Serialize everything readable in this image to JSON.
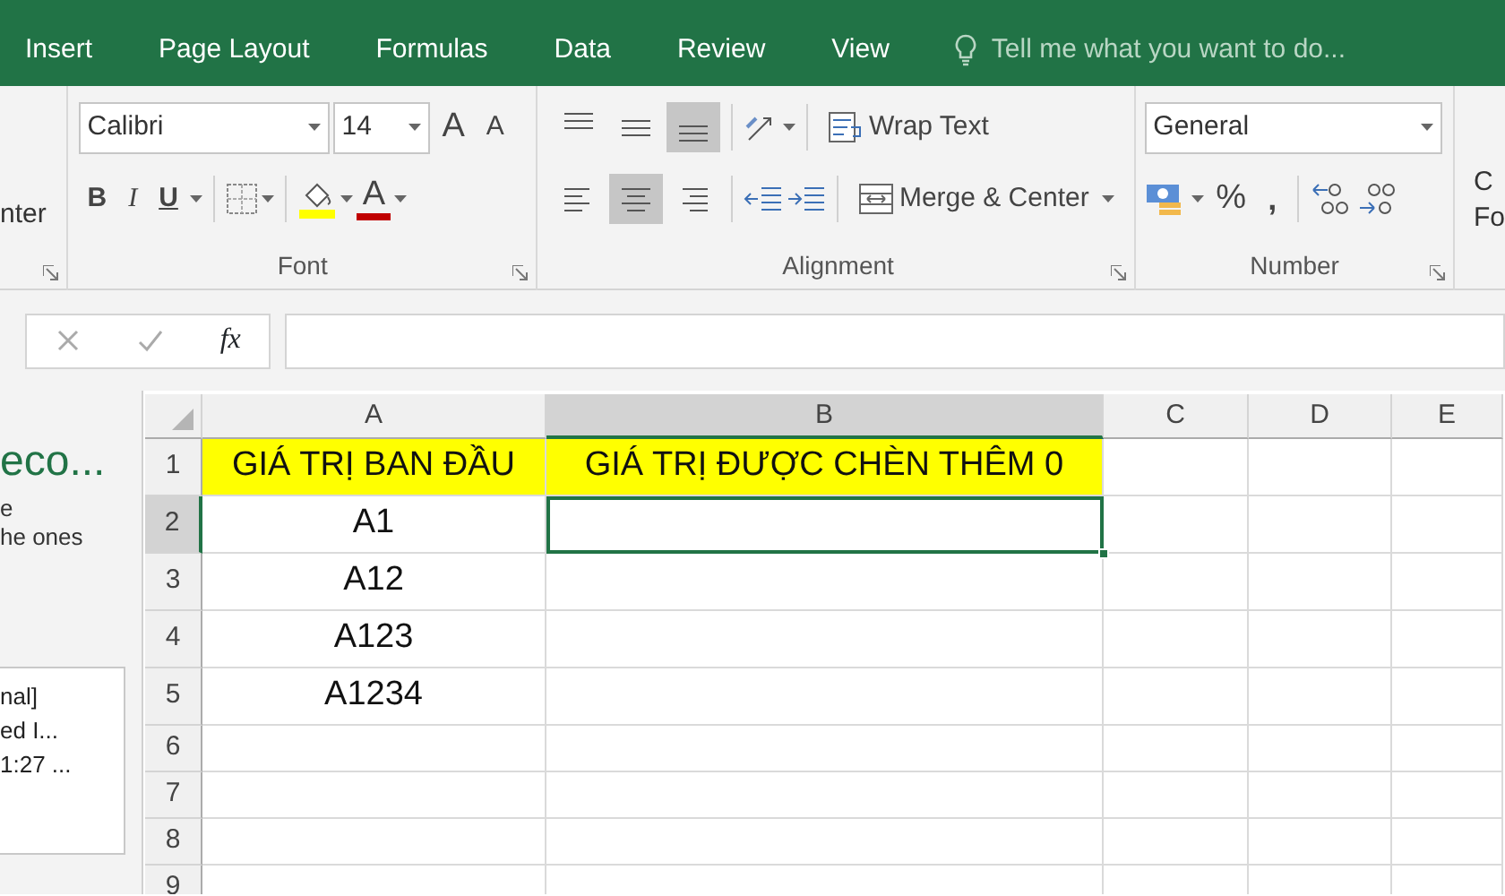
{
  "tabs": [
    {
      "label": "Insert",
      "selected": false
    },
    {
      "label": "Page Layout",
      "selected": false
    },
    {
      "label": "Formulas",
      "selected": false
    },
    {
      "label": "Data",
      "selected": false
    },
    {
      "label": "Review",
      "selected": false
    },
    {
      "label": "View",
      "selected": false
    }
  ],
  "tell_me": "Tell me what you want to do...",
  "ribbon": {
    "clipped_label": "nter",
    "font": {
      "name": "Calibri",
      "size": "14",
      "grow": "A",
      "shrink": "A",
      "bold": "B",
      "italic": "I",
      "underline": "U",
      "font_color": "A",
      "label": "Font"
    },
    "alignment": {
      "vertical": [
        {
          "kind": "top",
          "pressed": false
        },
        {
          "kind": "middle",
          "pressed": false
        },
        {
          "kind": "bottom",
          "pressed": true
        }
      ],
      "horizontal": [
        {
          "kind": "left",
          "pressed": false
        },
        {
          "kind": "center",
          "pressed": true
        },
        {
          "kind": "right",
          "pressed": false
        }
      ],
      "wrap": "Wrap Text",
      "merge": "Merge & Center",
      "label": "Alignment"
    },
    "number": {
      "format": "General",
      "percent": "%",
      "comma": ",",
      "label": "Number"
    },
    "clipped_group": [
      "C",
      "Fo"
    ]
  },
  "formula_bar": {
    "fx": "fx"
  },
  "side_panel": {
    "title": "eco...",
    "lines": [
      "e",
      "he ones"
    ],
    "file_lines": [
      "nal]",
      "ed I...",
      "1:27 ..."
    ]
  },
  "sheet": {
    "columns": [
      {
        "label": "A",
        "selected": false
      },
      {
        "label": "B",
        "selected": true
      },
      {
        "label": "C",
        "selected": false
      },
      {
        "label": "D",
        "selected": false
      },
      {
        "label": "E",
        "selected": false
      }
    ],
    "rows": [
      {
        "label": "1",
        "selected": false,
        "highlight": true,
        "cells": [
          "GIÁ TRỊ BAN ĐẦU",
          "GIÁ TRỊ ĐƯỢC CHÈN THÊM 0"
        ]
      },
      {
        "label": "2",
        "selected": true,
        "highlight": false,
        "cells": [
          "A1"
        ]
      },
      {
        "label": "3",
        "selected": false,
        "highlight": false,
        "cells": [
          "A12"
        ]
      },
      {
        "label": "4",
        "selected": false,
        "highlight": false,
        "cells": [
          "A123"
        ]
      },
      {
        "label": "5",
        "selected": false,
        "highlight": false,
        "cells": [
          "A1234"
        ]
      },
      {
        "label": "6",
        "selected": false,
        "highlight": false,
        "cells": []
      },
      {
        "label": "7",
        "selected": false,
        "highlight": false,
        "cells": []
      },
      {
        "label": "8",
        "selected": false,
        "highlight": false,
        "cells": []
      },
      {
        "label": "9",
        "selected": false,
        "highlight": false,
        "cells": []
      }
    ]
  }
}
